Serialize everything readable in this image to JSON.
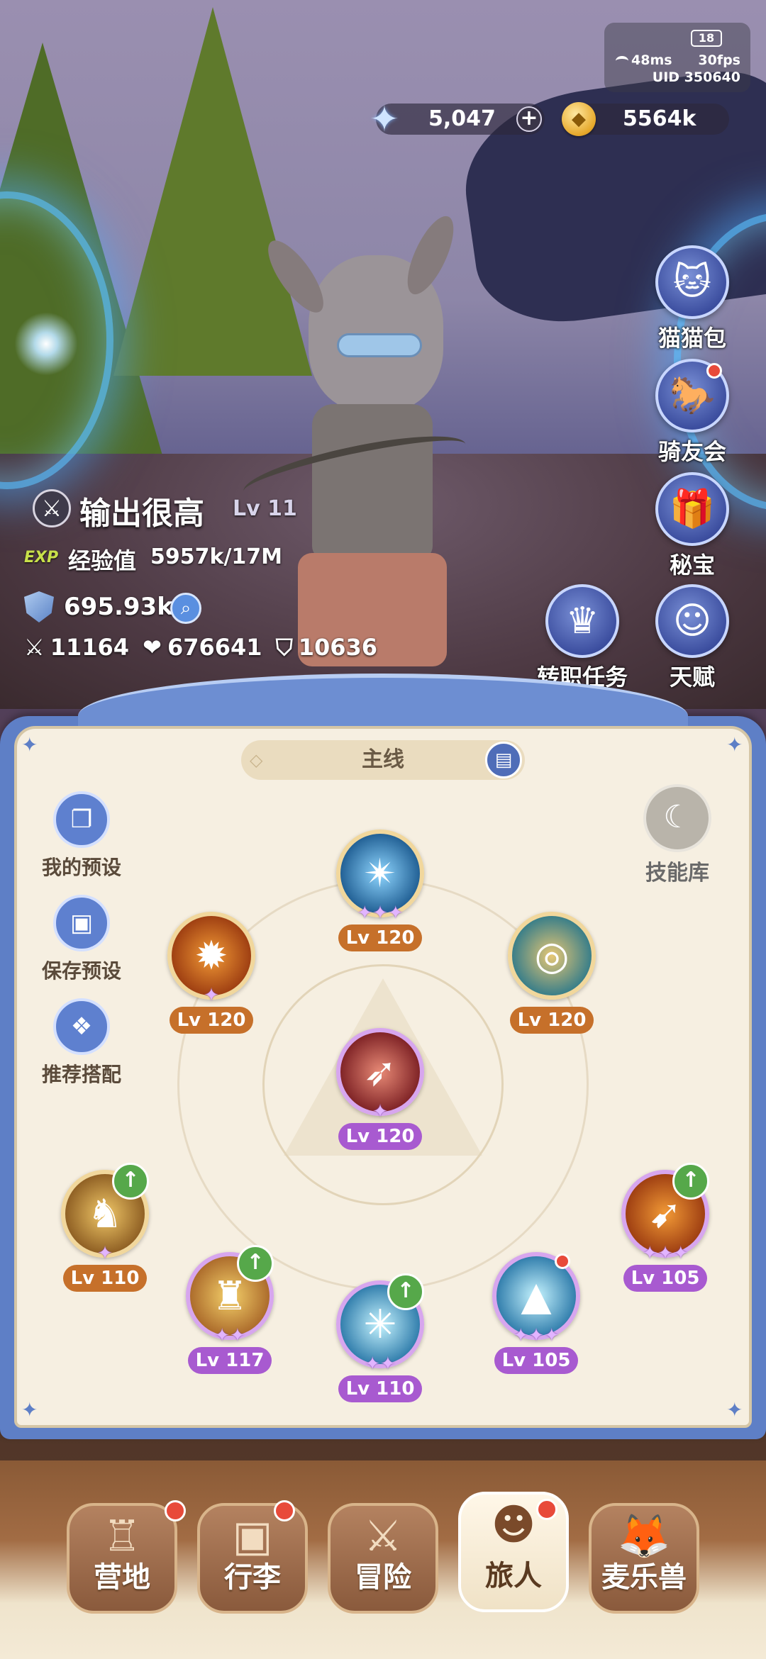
{
  "status": {
    "battery": "18",
    "ping": "48ms",
    "fps": "30fps",
    "uid": "UID 350640"
  },
  "currency": {
    "gems": "5,047",
    "gold": "5564k"
  },
  "side_menu": [
    {
      "label": "猫猫包",
      "icon": "cat-bag-icon",
      "badge": false
    },
    {
      "label": "骑友会",
      "icon": "mount-club-icon",
      "badge": true
    },
    {
      "label": "秘宝",
      "icon": "treasure-icon",
      "badge": false
    },
    {
      "label": "天赋",
      "icon": "talent-icon",
      "badge": false
    }
  ],
  "job_quest_label": "转职任务",
  "player": {
    "name": "输出很高",
    "level": "Lv 11",
    "exp_tag": "EXP",
    "exp_label": "经验值",
    "exp_value": "5957k/17M",
    "power": "695.93k",
    "attack": "11164",
    "hp": "676641",
    "defense": "10636"
  },
  "panel": {
    "tab_label": "主线",
    "left_buttons": [
      {
        "label": "我的预设",
        "icon": "preset-icon"
      },
      {
        "label": "保存预设",
        "icon": "save-icon"
      },
      {
        "label": "推荐搭配",
        "icon": "recommend-icon"
      }
    ],
    "skill_library_label": "技能库",
    "skills": [
      {
        "level": "Lv 120",
        "color": "orange",
        "stars": "✦✦✦",
        "art": "blue-bg"
      },
      {
        "level": "Lv 120",
        "color": "orange",
        "stars": "✦",
        "art": "orange-bg"
      },
      {
        "level": "Lv 120",
        "color": "orange",
        "stars": "",
        "art": "teal-bg"
      },
      {
        "level": "Lv 120",
        "color": "purple",
        "stars": "✦",
        "art": "red-bg"
      },
      {
        "level": "Lv 110",
        "color": "orange",
        "stars": "✦",
        "art": "gold-bg",
        "upgrade": true
      },
      {
        "level": "Lv 117",
        "color": "purple",
        "stars": "✦✦",
        "art": "bronze-bg",
        "upgrade": true
      },
      {
        "level": "Lv 110",
        "color": "purple",
        "stars": "✦✦",
        "art": "ice-bg",
        "upgrade": true
      },
      {
        "level": "Lv 105",
        "color": "purple",
        "stars": "✦✦✦",
        "art": "ice-bg",
        "badge": true
      },
      {
        "level": "Lv 105",
        "color": "purple",
        "stars": "✦✦✦",
        "art": "orange-bg",
        "upgrade": true
      }
    ]
  },
  "bottom_nav": [
    {
      "label": "营地",
      "icon": "castle-icon",
      "badge": true,
      "active": false
    },
    {
      "label": "行李",
      "icon": "backpack-icon",
      "badge": true,
      "active": false
    },
    {
      "label": "冒险",
      "icon": "crossed-swords-icon",
      "badge": false,
      "active": false
    },
    {
      "label": "旅人",
      "icon": "traveler-icon",
      "badge": true,
      "active": true
    },
    {
      "label": "麦乐兽",
      "icon": "pet-icon",
      "badge": false,
      "active": false
    }
  ],
  "colors": {
    "panel_blue": "#5e7fc6",
    "panel_cream": "#f6efe1",
    "badge_orange": "#c6702a",
    "badge_purple": "#a85ad0",
    "notify_red": "#e84a3a",
    "upgrade_green": "#56a84a"
  }
}
